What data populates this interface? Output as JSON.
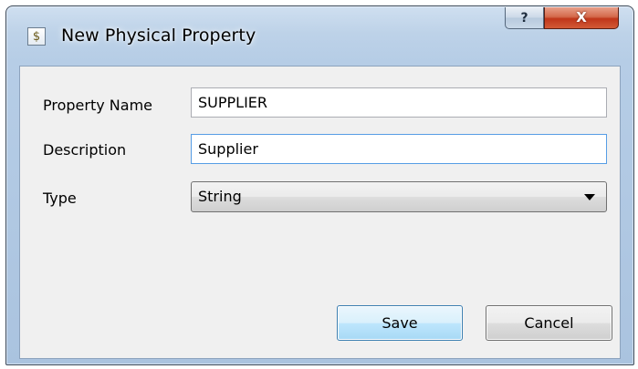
{
  "window": {
    "title": "New Physical Property",
    "app_icon": "dollar-document-icon",
    "app_icon_glyph": "$",
    "help_glyph": "?",
    "close_glyph": "X"
  },
  "form": {
    "property_name": {
      "label": "Property Name",
      "value": "SUPPLIER"
    },
    "description": {
      "label": "Description",
      "value": "Supplier"
    },
    "type": {
      "label": "Type",
      "value": "String"
    }
  },
  "buttons": {
    "save_label": "Save",
    "cancel_label": "Cancel"
  },
  "colors": {
    "titlebar": "#bdd2e8",
    "close_button": "#c0361a",
    "focus_border": "#569de5",
    "default_button_border": "#3c7fb1"
  }
}
